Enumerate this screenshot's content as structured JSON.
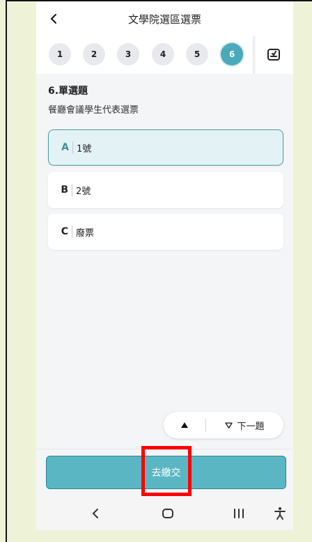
{
  "header": {
    "title": "文學院選區選票"
  },
  "steps": [
    "1",
    "2",
    "3",
    "4",
    "5",
    "6"
  ],
  "active_step": "6",
  "question": {
    "heading": "6.單選題",
    "text": "餐廳會議學生代表選票",
    "options": [
      {
        "letter": "A",
        "text": "1號",
        "selected": true
      },
      {
        "letter": "B",
        "text": "2號",
        "selected": false
      },
      {
        "letter": "C",
        "text": "廢票",
        "selected": false
      }
    ]
  },
  "navigation": {
    "next_label": "下一題"
  },
  "footer": {
    "submit_label": "去繳交"
  },
  "colors": {
    "accent": "#5bb6c4",
    "selected_bg": "#e3f2f4",
    "highlight": "#ff0000"
  },
  "icons": [
    "back-arrow-icon",
    "answer-sheet-icon",
    "triangle-up-icon",
    "triangle-down-icon",
    "system-back-icon",
    "home-icon",
    "recent-apps-icon",
    "accessibility-icon"
  ]
}
